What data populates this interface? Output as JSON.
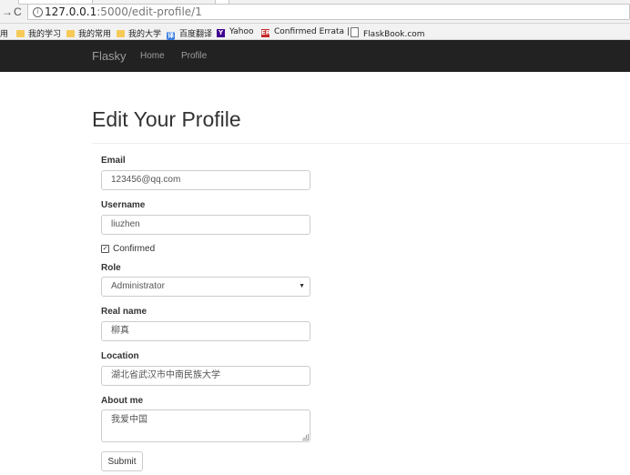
{
  "browser": {
    "url_host": "127.0.0.1",
    "url_path": ":5000/edit-profile/1",
    "bookmarks": [
      {
        "label": "用",
        "icon": "folder-icon"
      },
      {
        "label": "我的学习",
        "icon": "folder-icon"
      },
      {
        "label": "我的常用",
        "icon": "folder-icon"
      },
      {
        "label": "我的大学",
        "icon": "folder-icon"
      },
      {
        "label": "百度翻译",
        "icon": "fanyi-icon",
        "glyph": "译"
      },
      {
        "label": "Yahoo",
        "icon": "yahoo-icon",
        "glyph": "Y"
      },
      {
        "label": "Confirmed Errata | ",
        "icon": "errata-icon",
        "glyph": "ER"
      },
      {
        "label": "FlaskBook.com",
        "icon": "page-icon"
      }
    ]
  },
  "navbar": {
    "brand": "Flasky",
    "links": [
      "Home",
      "Profile"
    ]
  },
  "page": {
    "title": "Edit Your Profile"
  },
  "form": {
    "email_label": "Email",
    "email_value": "123456@qq.com",
    "username_label": "Username",
    "username_value": "liuzhen",
    "confirmed_label": "Confirmed",
    "confirmed_checked": true,
    "role_label": "Role",
    "role_value": "Administrator",
    "realname_label": "Real name",
    "realname_value": "柳真",
    "location_label": "Location",
    "location_value": "湖北省武汉市中南民族大学",
    "about_label": "About me",
    "about_value": "我爱中国",
    "submit_label": "Submit"
  },
  "colors": {
    "navbar_bg": "#222222",
    "navbar_text": "#9d9d9d",
    "folder": "#f7ca58"
  }
}
